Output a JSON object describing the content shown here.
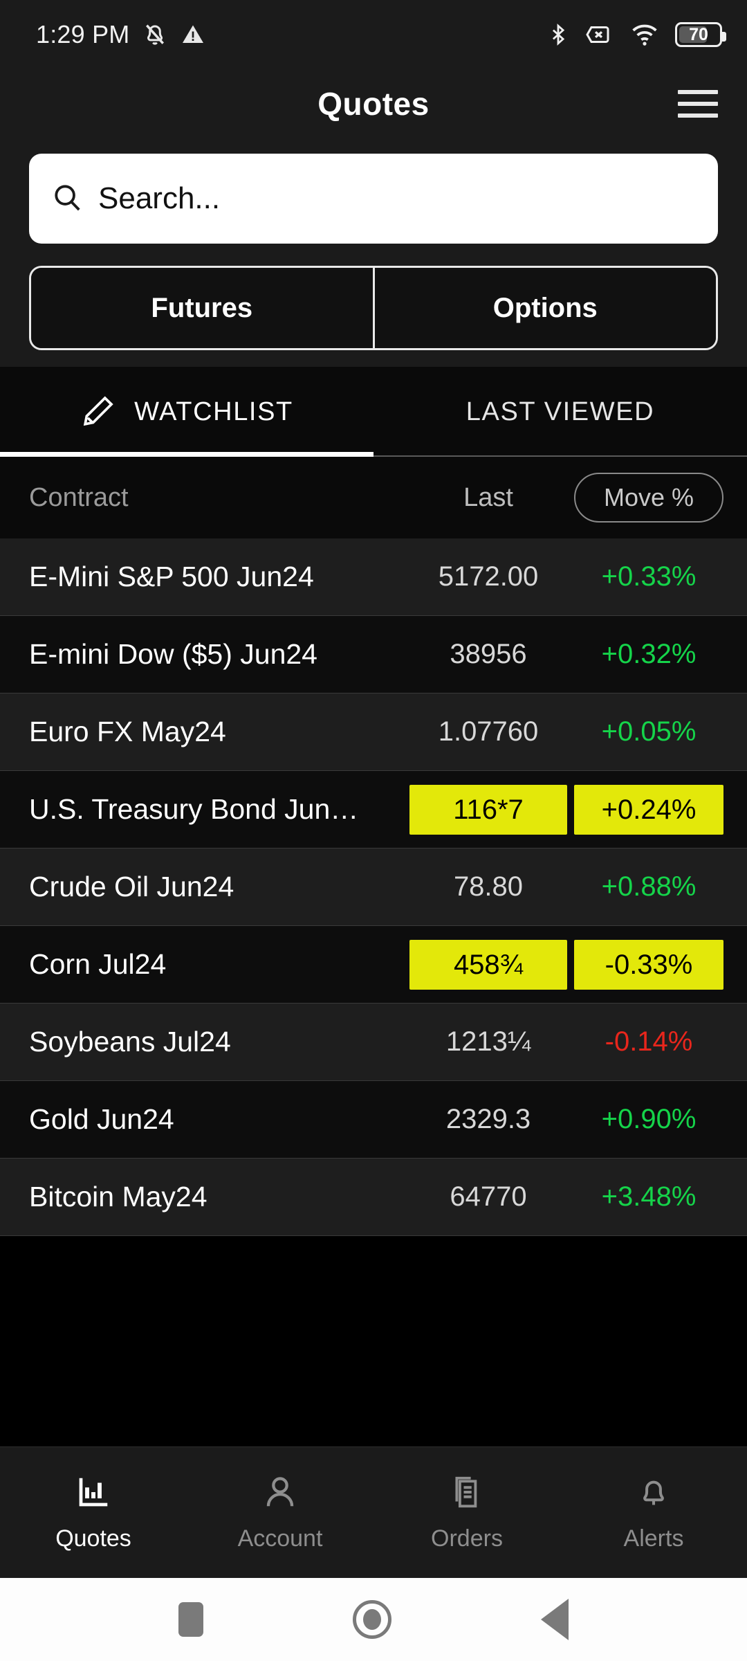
{
  "status_bar": {
    "time": "1:29 PM",
    "icons_left": [
      "bell-muted-icon",
      "warning-triangle-icon"
    ],
    "icons_right": [
      "bluetooth-icon",
      "no-sim-icon",
      "wifi-icon",
      "battery-icon"
    ],
    "battery_level": "70"
  },
  "header": {
    "title": "Quotes",
    "menu_icon": "hamburger-menu-icon"
  },
  "search": {
    "placeholder": "Search...",
    "value": "",
    "icon": "search-icon"
  },
  "segmented_control": {
    "options": [
      {
        "label": "Futures",
        "selected": true
      },
      {
        "label": "Options",
        "selected": false
      }
    ]
  },
  "tabs": [
    {
      "label": "WATCHLIST",
      "icon": "pencil-edit-icon",
      "active": true
    },
    {
      "label": "LAST VIEWED",
      "icon": "",
      "active": false
    }
  ],
  "table": {
    "columns": {
      "contract": "Contract",
      "last": "Last",
      "move": "Move %"
    },
    "rows": [
      {
        "contract": "E-Mini S&P 500 Jun24",
        "last": "5172.00",
        "move": "+0.33%",
        "direction": "up",
        "highlight": false
      },
      {
        "contract": "E-mini Dow ($5) Jun24",
        "last": "38956",
        "move": "+0.32%",
        "direction": "up",
        "highlight": false
      },
      {
        "contract": "Euro FX May24",
        "last": "1.07760",
        "move": "+0.05%",
        "direction": "up",
        "highlight": false
      },
      {
        "contract": "U.S. Treasury Bond Jun…",
        "last": "116*7",
        "move": "+0.24%",
        "direction": "up",
        "highlight": true
      },
      {
        "contract": "Crude Oil Jun24",
        "last": "78.80",
        "move": "+0.88%",
        "direction": "up",
        "highlight": false
      },
      {
        "contract": "Corn Jul24",
        "last": "458¾",
        "move": "-0.33%",
        "direction": "down",
        "highlight": true
      },
      {
        "contract": "Soybeans Jul24",
        "last": "1213¼",
        "move": "-0.14%",
        "direction": "down",
        "highlight": false
      },
      {
        "contract": "Gold Jun24",
        "last": "2329.3",
        "move": "+0.90%",
        "direction": "up",
        "highlight": false
      },
      {
        "contract": "Bitcoin May24",
        "last": "64770",
        "move": "+3.48%",
        "direction": "up",
        "highlight": false
      }
    ]
  },
  "bottom_nav": [
    {
      "label": "Quotes",
      "icon": "bar-chart-icon",
      "active": true
    },
    {
      "label": "Account",
      "icon": "person-icon",
      "active": false
    },
    {
      "label": "Orders",
      "icon": "documents-icon",
      "active": false
    },
    {
      "label": "Alerts",
      "icon": "bell-icon",
      "active": false
    }
  ],
  "android_nav": [
    {
      "name": "recents-button"
    },
    {
      "name": "home-button"
    },
    {
      "name": "back-button"
    }
  ],
  "colors": {
    "up": "#15d44a",
    "down": "#e8261c",
    "highlight": "#e3e80a",
    "background": "#000000",
    "panel": "#1b1b1b"
  }
}
